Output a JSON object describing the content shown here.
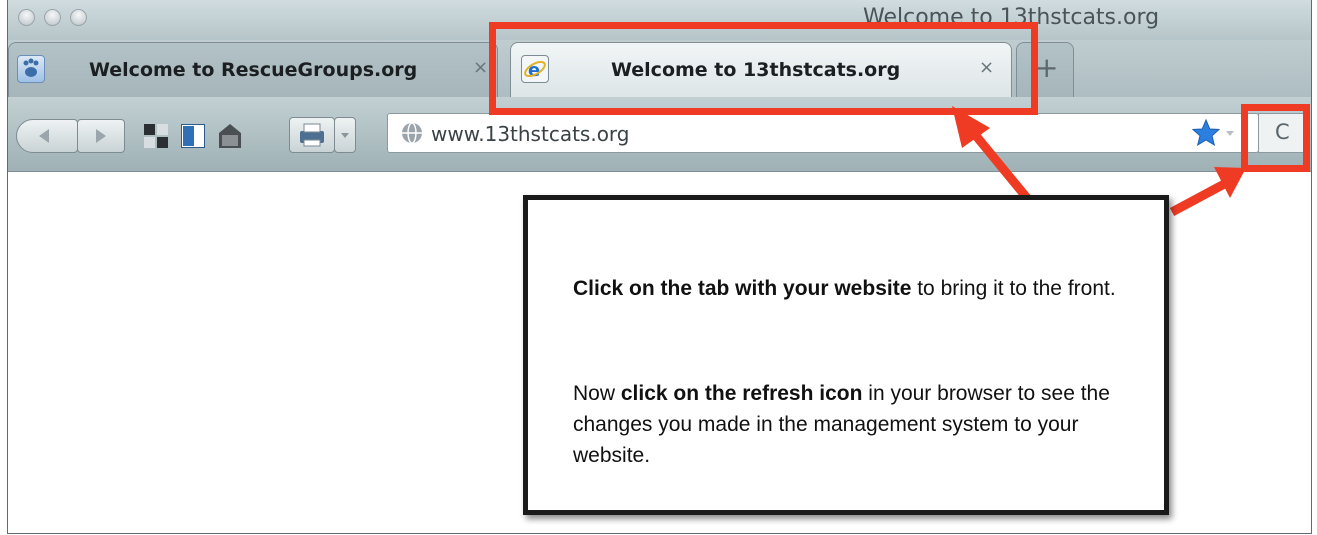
{
  "window": {
    "title": "Welcome to 13thstcats.org"
  },
  "tabs": [
    {
      "label": "Welcome to RescueGroups.org",
      "close": "×",
      "icon": "paw-icon",
      "active": false
    },
    {
      "label": "Welcome to 13thstcats.org",
      "close": "×",
      "icon": "ie-icon",
      "active": true
    }
  ],
  "new_tab": {
    "label": "+"
  },
  "toolbar": {
    "reload_label": "C"
  },
  "address": {
    "url": "www.13thstcats.org"
  },
  "callout": {
    "p1_bold": "Click on the tab with your website",
    "p1_rest": " to bring it to the front.",
    "p2_start": "Now ",
    "p2_bold": "click on the refresh icon",
    "p2_rest": " in your browser to see the changes you made in the management system to your website."
  },
  "colors": {
    "highlight": "#ef3b24",
    "callout_border": "#1a1a1a",
    "bookmark_star": "#2a7fe0"
  }
}
